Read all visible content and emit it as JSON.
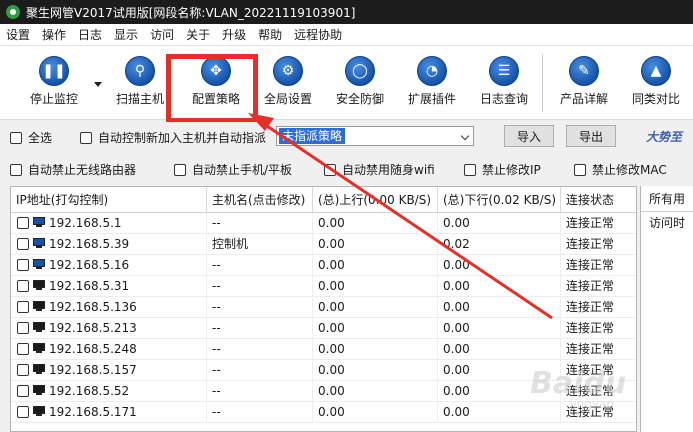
{
  "window": {
    "title": "聚生网管V2017试用版[网段名称:VLAN_20221119103901]"
  },
  "menu": [
    "设置",
    "操作",
    "日志",
    "显示",
    "访问",
    "关于",
    "升级",
    "帮助",
    "远程协助"
  ],
  "toolbar": {
    "stop": "停止监控",
    "scan": "扫描主机",
    "policy": "配置策略",
    "global": "全局设置",
    "security": "安全防御",
    "plugins": "扩展插件",
    "logs": "日志查询",
    "product": "产品详解",
    "compare": "同类对比"
  },
  "options": {
    "select_all": "全选",
    "auto_control": "自动控制新加入主机并自动指派",
    "policy_select": "未指派策略",
    "import": "导入",
    "export": "导出",
    "brand": "大势至",
    "block_wifi_router": "自动禁止无线路由器",
    "block_phone": "自动禁止手机/平板",
    "block_portable_wifi": "自动禁用随身wifi",
    "block_ip_change": "禁止修改IP",
    "block_mac_change": "禁止修改MAC"
  },
  "table": {
    "headers": [
      "IP地址(打勾控制)",
      "主机名(点击修改)",
      "(总)上行(0.00 KB/S)",
      "(总)下行(0.02 KB/S)",
      "连接状态"
    ],
    "rows": [
      {
        "ip": "192.168.5.1",
        "host": "--",
        "up": "0.00",
        "down": "0.00",
        "status": "连接正常",
        "icon": "blue"
      },
      {
        "ip": "192.168.5.39",
        "host": "控制机",
        "up": "0.00",
        "down": "0.02",
        "status": "连接正常",
        "icon": "blue"
      },
      {
        "ip": "192.168.5.16",
        "host": "--",
        "up": "0.00",
        "down": "0.00",
        "status": "连接正常",
        "icon": "blue"
      },
      {
        "ip": "192.168.5.31",
        "host": "--",
        "up": "0.00",
        "down": "0.00",
        "status": "连接正常",
        "icon": "black"
      },
      {
        "ip": "192.168.5.136",
        "host": "--",
        "up": "0.00",
        "down": "0.00",
        "status": "连接正常",
        "icon": "black"
      },
      {
        "ip": "192.168.5.213",
        "host": "--",
        "up": "0.00",
        "down": "0.00",
        "status": "连接正常",
        "icon": "black"
      },
      {
        "ip": "192.168.5.248",
        "host": "--",
        "up": "0.00",
        "down": "0.00",
        "status": "连接正常",
        "icon": "black"
      },
      {
        "ip": "192.168.5.157",
        "host": "--",
        "up": "0.00",
        "down": "0.00",
        "status": "连接正常",
        "icon": "black"
      },
      {
        "ip": "192.168.5.52",
        "host": "--",
        "up": "0.00",
        "down": "0.00",
        "status": "连接正常",
        "icon": "black"
      },
      {
        "ip": "192.168.5.171",
        "host": "--",
        "up": "0.00",
        "down": "0.00",
        "status": "连接正常",
        "icon": "black"
      }
    ]
  },
  "right_panel": {
    "header": "所有用",
    "sub": "访问时"
  },
  "colors": {
    "highlight": "#e5302a",
    "arrow": "#e5302a",
    "selection": "#2c6ed8",
    "icon_blue": "#1553a8"
  }
}
